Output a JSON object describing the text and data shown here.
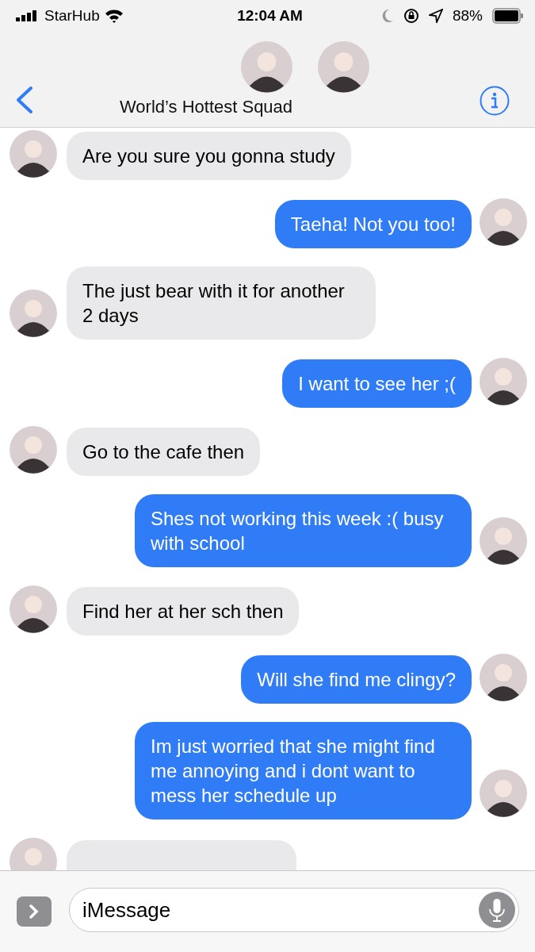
{
  "status_bar": {
    "carrier": "StarHub",
    "time": "12:04 AM",
    "battery": "88%"
  },
  "header": {
    "title": "World’s Hottest Squad"
  },
  "messages": [
    {
      "kind": "incoming",
      "text": "Are you sure you gonna study"
    },
    {
      "kind": "outgoing",
      "text": "Taeha! Not you too!"
    },
    {
      "kind": "incoming",
      "text": "The just bear with it for another 2 days"
    },
    {
      "kind": "outgoing",
      "text": "I want to see her ;("
    },
    {
      "kind": "incoming",
      "text": "Go to the cafe then"
    },
    {
      "kind": "outgoing",
      "text": "Shes not working this week :( busy with school"
    },
    {
      "kind": "incoming",
      "text": "Find her at her sch then"
    },
    {
      "kind": "outgoing",
      "text": "Will she find me clingy?"
    },
    {
      "kind": "outgoing",
      "text": "Im just worried that she might find me annoying and i dont want to mess her schedule up"
    },
    {
      "kind": "cut"
    }
  ],
  "input": {
    "placeholder": "iMessage"
  }
}
